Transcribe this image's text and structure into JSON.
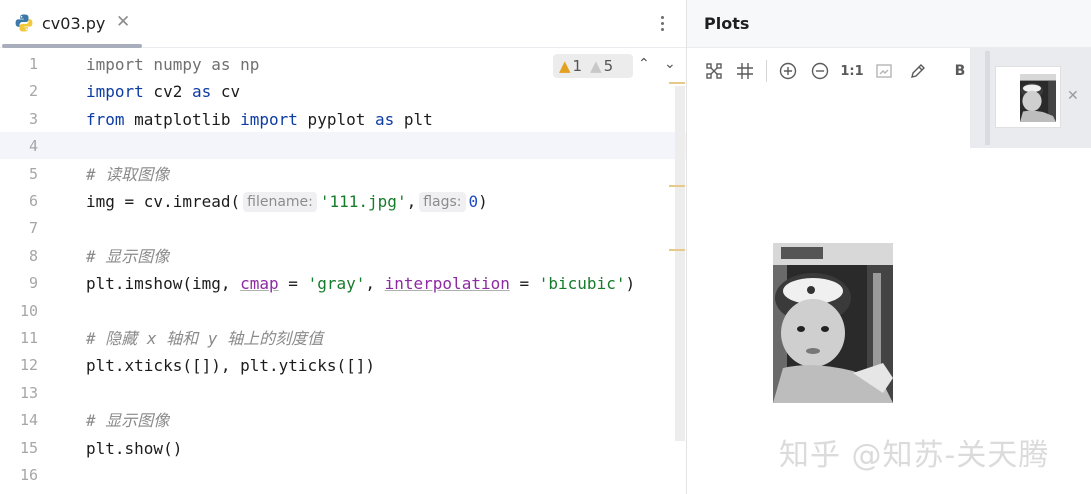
{
  "editor": {
    "tab": {
      "title": "cv03.py",
      "close_glyph": "✕",
      "icon": "python-icon"
    },
    "more_glyph": "⋮",
    "inspections": {
      "warnings": "1",
      "weak_warnings": "5",
      "up": "⌃",
      "down": "⌄"
    },
    "line_numbers": [
      "1",
      "2",
      "3",
      "4",
      "5",
      "6",
      "7",
      "8",
      "9",
      "10",
      "11",
      "12",
      "13",
      "14",
      "15",
      "16"
    ],
    "lines": [
      {
        "parts": [
          {
            "t": "import",
            "c": "kw-dim"
          },
          {
            "t": " numpy ",
            "c": "kw-dim"
          },
          {
            "t": "as",
            "c": "kw-dim"
          },
          {
            "t": " np",
            "c": "kw-dim"
          }
        ]
      },
      {
        "parts": [
          {
            "t": "import",
            "c": "kw"
          },
          {
            "t": " cv2 ",
            "c": ""
          },
          {
            "t": "as",
            "c": "kw"
          },
          {
            "t": " cv",
            "c": ""
          }
        ]
      },
      {
        "parts": [
          {
            "t": "from",
            "c": "kw"
          },
          {
            "t": " matplotlib ",
            "c": ""
          },
          {
            "t": "import",
            "c": "kw"
          },
          {
            "t": " pyplot ",
            "c": ""
          },
          {
            "t": "as",
            "c": "kw"
          },
          {
            "t": " plt",
            "c": ""
          }
        ]
      },
      {
        "parts": []
      },
      {
        "parts": [
          {
            "t": "# 读取图像",
            "c": "cmt"
          }
        ]
      },
      {
        "parts": [
          {
            "t": "img = cv.imread(",
            "c": ""
          },
          {
            "t": "filename:",
            "c": "hint"
          },
          {
            "t": "'111.jpg'",
            "c": "str"
          },
          {
            "t": ",",
            "c": ""
          },
          {
            "t": "flags:",
            "c": "hint"
          },
          {
            "t": "0",
            "c": "num"
          },
          {
            "t": ")",
            "c": ""
          }
        ]
      },
      {
        "parts": []
      },
      {
        "parts": [
          {
            "t": "# 显示图像",
            "c": "cmt"
          }
        ]
      },
      {
        "parts": [
          {
            "t": "plt.imshow(img, ",
            "c": ""
          },
          {
            "t": "cmap",
            "c": "eq-box"
          },
          {
            "t": " = ",
            "c": ""
          },
          {
            "t": "'gray'",
            "c": "str"
          },
          {
            "t": ", ",
            "c": ""
          },
          {
            "t": "interpolation",
            "c": "eq-box"
          },
          {
            "t": " = ",
            "c": ""
          },
          {
            "t": "'bicubic'",
            "c": "str"
          },
          {
            "t": ")",
            "c": ""
          }
        ]
      },
      {
        "parts": []
      },
      {
        "parts": [
          {
            "t": "# 隐藏 x 轴和 y 轴上的刻度值",
            "c": "cmt"
          }
        ]
      },
      {
        "parts": [
          {
            "t": "plt.xticks([]), plt.yticks([])",
            "c": ""
          }
        ]
      },
      {
        "parts": []
      },
      {
        "parts": [
          {
            "t": "# 显示图像",
            "c": "cmt"
          }
        ]
      },
      {
        "parts": [
          {
            "t": "plt.show()",
            "c": ""
          }
        ]
      },
      {
        "parts": []
      }
    ]
  },
  "plots": {
    "title": "Plots",
    "toolbar": {
      "fit_label": "fit-to-window",
      "grid_label": "grid",
      "zoom_in_label": "zoom-in",
      "zoom_out_label": "zoom-out",
      "actual_size_label": "1:1",
      "image_label": "image",
      "edit_label": "edit",
      "extra_label": "B"
    },
    "thumbnail_close": "✕"
  },
  "watermark": "知乎 @知苏-关天腾"
}
